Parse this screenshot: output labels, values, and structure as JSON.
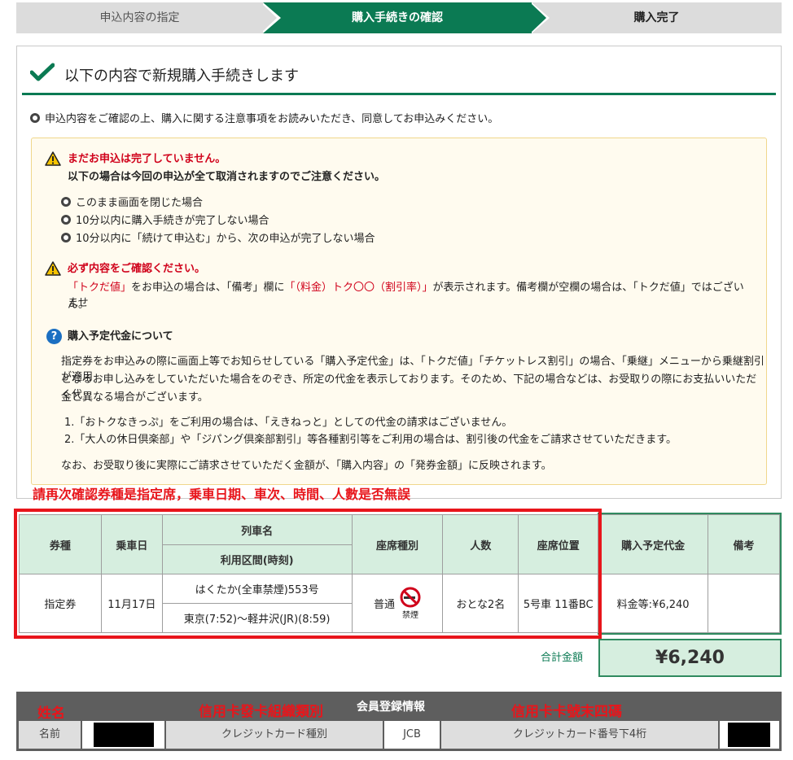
{
  "steps": {
    "step1": "申込内容の指定",
    "step2": "購入手続きの確認",
    "step3": "購入完了"
  },
  "panel": {
    "title": "以下の内容で新規購入手続きします",
    "intro": "申込内容をご確認の上、購入に関する注意事項をお読みいただき、同意してお申込みください。"
  },
  "notice": {
    "warn1_title": "まだお申込は完了していません。",
    "warn1_sub": "以下の場合は今回の申込が全て取消されますのでご注意ください。",
    "warn1_items": [
      "このまま画面を閉じた場合",
      "10分以内に購入手続きが完了しない場合",
      "10分以内に「続けて申込む」から、次の申込が完了しない場合"
    ],
    "warn2_title": "必ず内容をご確認ください。",
    "warn2_text_a": "「トクだ値」",
    "warn2_text_b": "をお申込の場合は、「備考」欄に",
    "warn2_text_c": "「（料金）トク〇〇（割引率）」",
    "warn2_text_d": "が表示されます。備考欄が空欄の場合は、「トクだ値」ではございませ",
    "warn2_text_e": "ん。",
    "q_title": "購入予定代金について",
    "q_p1_l1": "指定券をお申込みの際に画面上等でお知らせしている「購入予定代金」は、「トクだ値」「チケットレス割引」の場合、「乗継」メニューから乗継割引が適用",
    "q_p1_l2": "となるお申し込みをしていただいた場合をのぞき、所定の代金を表示しております。そのため、下記の場合などは、お受取りの際にお支払いいただく代",
    "q_p1_l3": "金と異なる場合がございます。",
    "q_list1": "1.「おトクなきっぷ」をご利用の場合は、「えきねっと」としての代金の請求はございません。",
    "q_list2": "2.「大人の休日倶楽部」や「ジパング倶楽部割引」等各種割引等をご利用の場合は、割引後の代金をご請求させていただきます。",
    "q_p2": "なお、お受取り後に実際にご請求させていただく金額が、「購入内容」の「発券金額」に反映されます。"
  },
  "annotations": {
    "check_note": "請再次確認券種是指定席，乗車日期、車次、時間、人數是否無誤",
    "name_note": "姓名",
    "card_brand_note": "信用卡發卡組織類別",
    "card_last4_note": "信用卡卡號末四碼"
  },
  "ticket_table": {
    "headers": {
      "kind": "券種",
      "date": "乗車日",
      "train_name": "列車名",
      "section": "利用区間(時刻)",
      "seat_type": "座席種別",
      "people": "人数",
      "seat_pos": "座席位置",
      "price": "購入予定代金",
      "remarks": "備考"
    },
    "row": {
      "kind": "指定券",
      "date": "11月17日",
      "train_name": "はくたか(全車禁煙)553号",
      "section": "東京(7:52)～軽井沢(JR)(8:59)",
      "seat_type": "普通",
      "no_smoking": "禁煙",
      "people": "おとな2名",
      "seat_pos": "5号車 11番BC",
      "price": "料金等:¥6,240",
      "remarks": ""
    },
    "total_label": "合計金額",
    "total_value": "¥6,240"
  },
  "member": {
    "title": "会員登録情報",
    "name_label": "名前",
    "card_type_label": "クレジットカード種別",
    "card_type_value": "JCB",
    "card_last4_label": "クレジットカード番号下4桁"
  },
  "colors": {
    "accent_green": "#0b7a53",
    "alert_red": "#d0021b",
    "annotation_red": "#e8151b"
  }
}
